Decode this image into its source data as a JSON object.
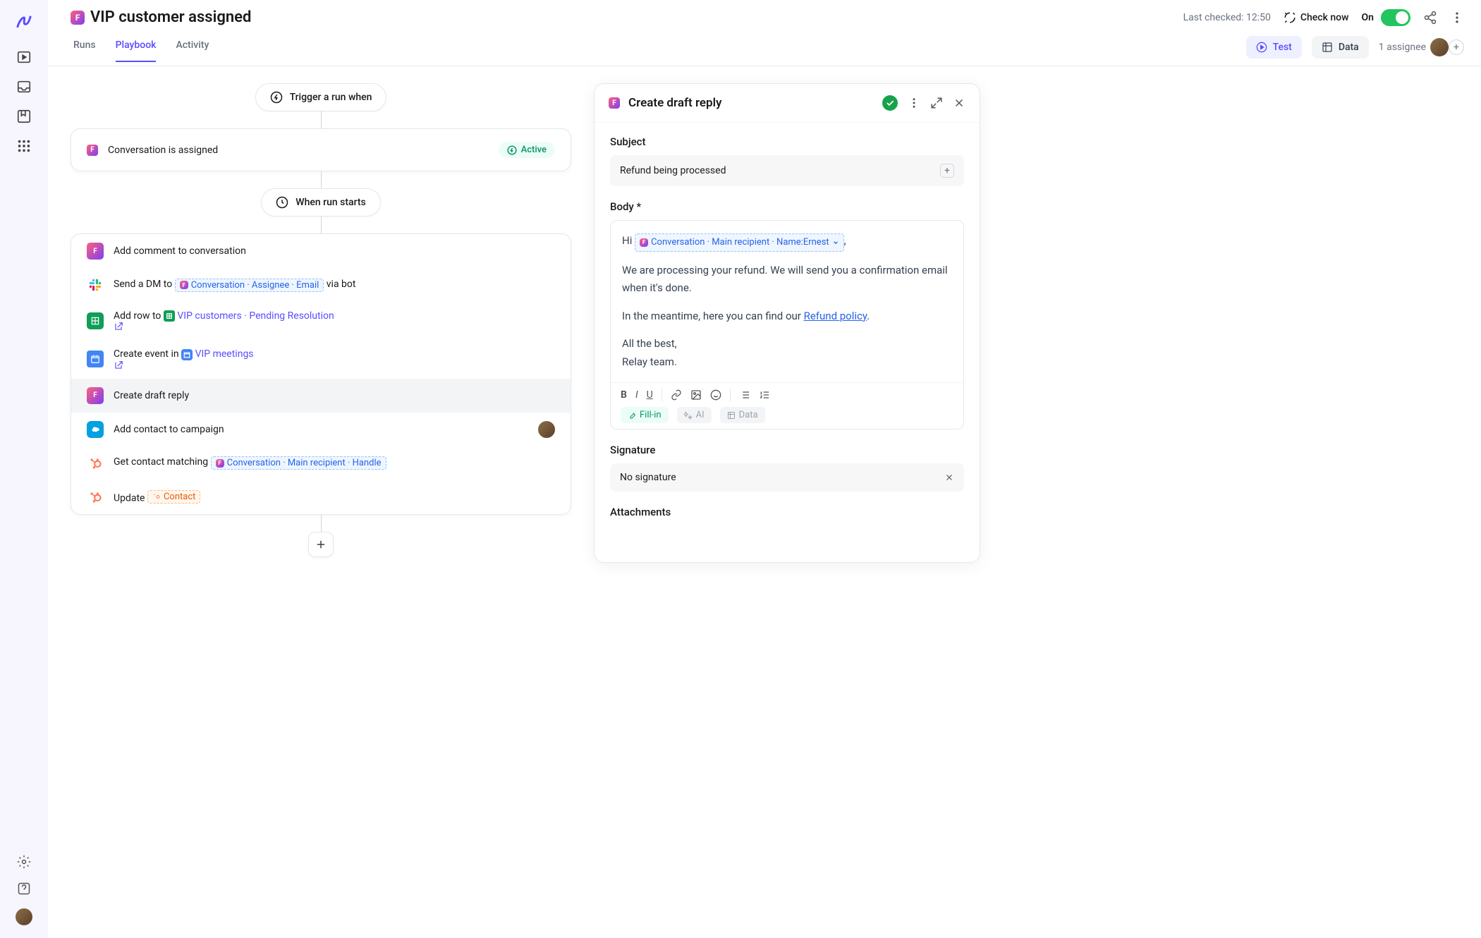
{
  "header": {
    "title": "VIP customer assigned",
    "lastChecked": "Last checked: 12:50",
    "checkNow": "Check now",
    "onLabel": "On"
  },
  "tabs": {
    "runs": "Runs",
    "playbook": "Playbook",
    "activity": "Activity",
    "test": "Test",
    "data": "Data",
    "assignees": "1 assignee"
  },
  "flow": {
    "triggerLabel": "Trigger a run when",
    "triggerCard": "Conversation is assigned",
    "activeBadge": "Active",
    "whenRunStarts": "When run starts"
  },
  "steps": [
    {
      "text": "Add comment to conversation",
      "icon": "front",
      "type": "plain"
    },
    {
      "prefix": "Send a DM to ",
      "chip": "Conversation · Assignee · Email",
      "suffix": " via bot",
      "icon": "slack"
    },
    {
      "prefix": "Add row to ",
      "linkIcon": "sheets",
      "link": "VIP customers · Pending Resolution",
      "icon": "sheets",
      "ext": true
    },
    {
      "prefix": "Create event in ",
      "linkIcon": "cal",
      "link": "VIP meetings",
      "icon": "cal",
      "ext": true
    },
    {
      "text": "Create draft reply",
      "icon": "front",
      "selected": true
    },
    {
      "text": "Add contact to campaign",
      "icon": "sf",
      "avatar": true
    },
    {
      "prefix": "Get contact matching ",
      "chip": "Conversation · Main recipient · Handle",
      "icon": "hs"
    },
    {
      "prefix": "Update ",
      "chipOrange": "Contact",
      "icon": "hs"
    }
  ],
  "panel": {
    "title": "Create draft reply",
    "subjectLabel": "Subject",
    "subjectValue": "Refund being processed",
    "bodyLabel": "Body *",
    "body": {
      "hi": "Hi ",
      "recipient": "Conversation · Main recipient · Name:Ernest",
      "comma": ",",
      "p1": "We are processing your refund. We will send you a confirmation email when it's done.",
      "p2a": "In the meantime, here you can find our ",
      "p2link": "Refund policy",
      "p2b": ".",
      "p3a": "All the best,",
      "p3b": "Relay team."
    },
    "fillIn": "Fill-in",
    "ai": "AI",
    "dataPill": "Data",
    "signatureLabel": "Signature",
    "signatureValue": "No signature",
    "attachmentsLabel": "Attachments"
  }
}
